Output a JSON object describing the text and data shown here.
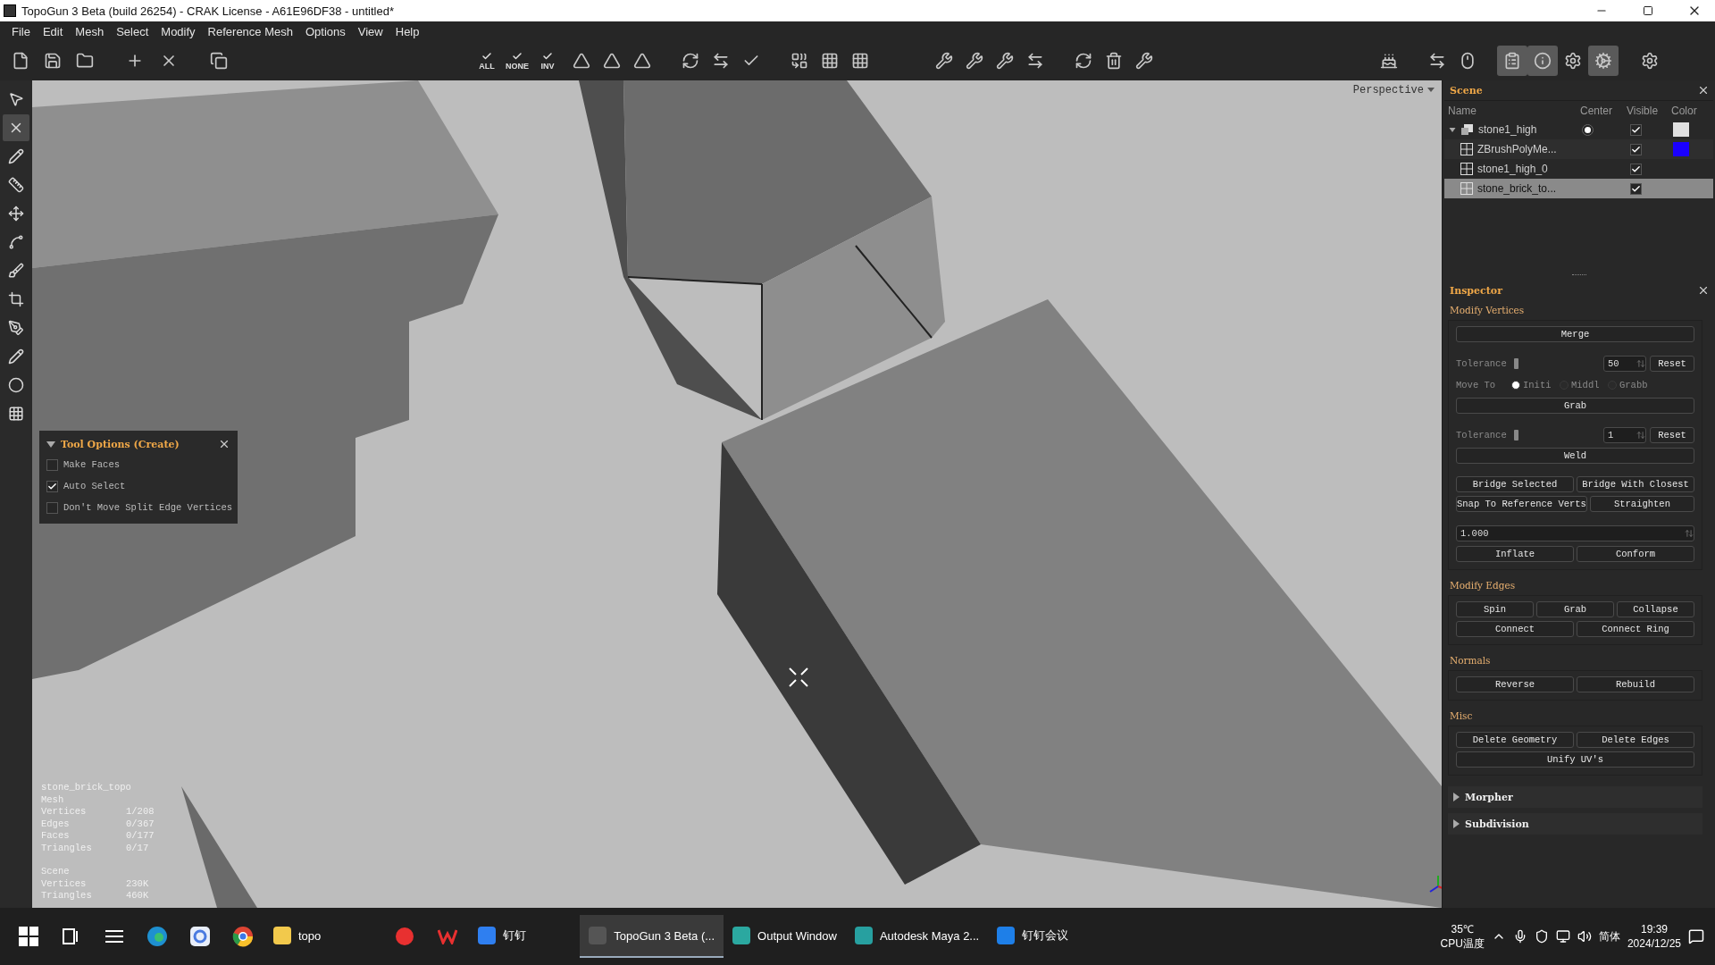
{
  "window": {
    "title": "TopoGun 3 Beta (build 26254) - CRAK License - A61E96DF38 - untitled*"
  },
  "menu": [
    "File",
    "Edit",
    "Mesh",
    "Select",
    "Modify",
    "Reference Mesh",
    "Options",
    "View",
    "Help"
  ],
  "toolbar": {
    "select_buttons": [
      {
        "label": "ALL"
      },
      {
        "label": "NONE"
      },
      {
        "label": "INV"
      }
    ],
    "panel_toggles": [
      {
        "selected": true
      },
      {
        "selected": true
      },
      {
        "selected": false
      },
      {
        "selected": true
      }
    ]
  },
  "tools": [
    {
      "selected": false
    },
    {
      "selected": true
    },
    {
      "selected": false
    },
    {
      "selected": false
    },
    {
      "selected": false
    },
    {
      "selected": false
    },
    {
      "selected": false
    },
    {
      "selected": false
    },
    {
      "selected": false
    },
    {
      "selected": false
    },
    {
      "selected": false
    },
    {
      "selected": false
    }
  ],
  "viewport": {
    "camera": "Perspective",
    "tool_options": {
      "title": "Tool Options (Create)",
      "expanded": true,
      "options": [
        {
          "label": "Make Faces",
          "checked": false
        },
        {
          "label": "Auto Select",
          "checked": true
        },
        {
          "label": "Don't Move Split Edge Vertices",
          "checked": false
        }
      ]
    },
    "stats": {
      "object": "stone_brick_topo",
      "mesh_title": "Mesh",
      "mesh": [
        {
          "label": "Vertices",
          "value": "1/208"
        },
        {
          "label": "Edges",
          "value": "0/367"
        },
        {
          "label": "Faces",
          "value": "0/177"
        },
        {
          "label": "Triangles",
          "value": "0/17"
        }
      ],
      "scene_title": "Scene",
      "scene": [
        {
          "label": "Vertices",
          "value": "230K"
        },
        {
          "label": "Triangles",
          "value": "460K"
        }
      ]
    }
  },
  "scene": {
    "title": "Scene",
    "columns": [
      "Name",
      "Center",
      "Visible",
      "Color"
    ],
    "rows": [
      {
        "name": "stone1_high",
        "expanded": true,
        "center": true,
        "visible": true,
        "color": "#e0e0e0",
        "selected": false,
        "children": [
          {
            "name": "ZBrushPolyMe...",
            "visible": true,
            "color": "#1a00ff",
            "selected": false
          },
          {
            "name": "stone1_high_0",
            "visible": true,
            "selected": false
          },
          {
            "name": "stone_brick_to...",
            "visible": true,
            "selected": true
          }
        ]
      }
    ]
  },
  "inspector": {
    "title": "Inspector",
    "sections": [
      {
        "title": "Modify Vertices",
        "expanded": true,
        "groups": [
          [
            {
              "kind": "buttons",
              "buttons": [
                "Merge"
              ]
            }
          ],
          [
            {
              "kind": "slider",
              "label": "Tolerance",
              "value": "50",
              "action": "Reset"
            },
            {
              "kind": "radio",
              "label": "Move To",
              "options": [
                {
                  "label": "Initi",
                  "selected": true
                },
                {
                  "label": "Middl",
                  "selected": false
                },
                {
                  "label": "Grabb",
                  "selected": false
                }
              ]
            },
            {
              "kind": "buttons",
              "buttons": [
                "Grab"
              ]
            }
          ],
          [
            {
              "kind": "slider",
              "label": "Tolerance",
              "value": "1",
              "action": "Reset"
            },
            {
              "kind": "buttons",
              "buttons": [
                "Weld"
              ]
            }
          ],
          [
            {
              "kind": "buttons",
              "buttons": [
                "Bridge Selected",
                "Bridge With Closest"
              ]
            },
            {
              "kind": "buttons",
              "buttons": [
                "Snap To Reference Verts",
                "Straighten"
              ]
            }
          ],
          [
            {
              "kind": "spin",
              "value": "1.000"
            },
            {
              "kind": "buttons",
              "buttons": [
                "Inflate",
                "Conform"
              ]
            }
          ]
        ]
      },
      {
        "title": "Modify Edges",
        "expanded": true,
        "groups": [
          [
            {
              "kind": "buttons",
              "buttons": [
                "Spin",
                "Grab",
                "Collapse"
              ]
            },
            {
              "kind": "buttons",
              "buttons": [
                "Connect",
                "Connect Ring"
              ]
            }
          ]
        ]
      },
      {
        "title": "Normals",
        "expanded": true,
        "groups": [
          [
            {
              "kind": "buttons",
              "buttons": [
                "Reverse",
                "Rebuild"
              ]
            }
          ]
        ]
      },
      {
        "title": "Misc",
        "expanded": true,
        "groups": [
          [
            {
              "kind": "buttons",
              "buttons": [
                "Delete Geometry",
                "Delete Edges"
              ]
            },
            {
              "kind": "buttons",
              "buttons": [
                "Unify UV's"
              ]
            }
          ]
        ]
      },
      {
        "title": "Morpher",
        "expanded": false
      },
      {
        "title": "Subdivision",
        "expanded": false
      }
    ]
  },
  "taskbar": {
    "apps": [
      {
        "label": "topo",
        "selected": false
      },
      {
        "label": "钉钉",
        "selected": false
      },
      {
        "label": "TopoGun 3 Beta (...",
        "selected": true
      },
      {
        "label": "Output Window",
        "selected": false
      },
      {
        "label": "Autodesk Maya 2...",
        "selected": false
      },
      {
        "label": "钉钉会议",
        "selected": false
      }
    ],
    "temperature": "35℃",
    "sensor": "CPU温度",
    "ime": "简体",
    "time": "19:39",
    "date": "2024/12/25"
  }
}
